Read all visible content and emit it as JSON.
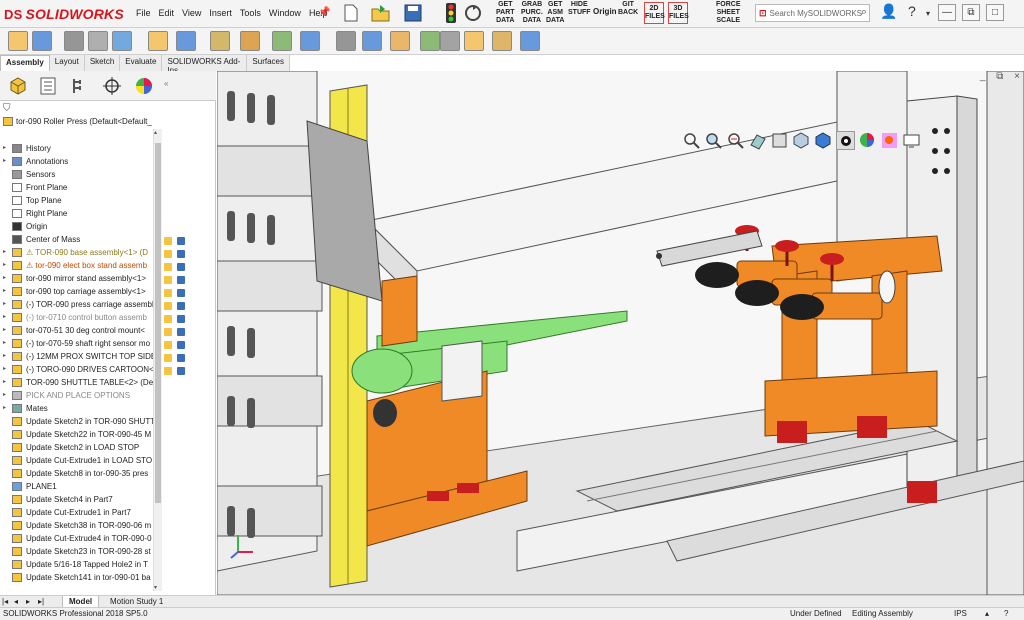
{
  "app": {
    "logo_ds": "DS",
    "logo_name": "SOLIDWORKS"
  },
  "menu": [
    "File",
    "Edit",
    "View",
    "Insert",
    "Tools",
    "Window",
    "Help"
  ],
  "custom_tools": [
    {
      "label": "GET\nPART\nDATA"
    },
    {
      "label": "GRAB\nPURC.\nDATA"
    },
    {
      "label": "GET\nASM\nDATA"
    },
    {
      "label": "HIDE\nSTUFF"
    },
    {
      "label": "Origin"
    },
    {
      "label": "GIT\nBACK"
    },
    {
      "label": "2D\nFILES"
    },
    {
      "label": "3D\nFILES"
    },
    {
      "label": "FORCE\nSHEET\nSCALE"
    }
  ],
  "search": {
    "placeholder": "Search MySOLIDWORKS"
  },
  "command_tabs": [
    "Assembly",
    "Layout",
    "Sketch",
    "Evaluate",
    "SOLIDWORKS Add-Ins",
    "Surfaces"
  ],
  "tree": [
    {
      "label": "tor-090 Roller Press  (Default<Default_",
      "icon": "assembly",
      "expand": "",
      "style": "normal"
    },
    {
      "label": "History",
      "icon": "history",
      "expand": "▸",
      "style": "normal"
    },
    {
      "label": "Annotations",
      "icon": "annotation",
      "expand": "▸",
      "style": "normal"
    },
    {
      "label": "Sensors",
      "icon": "sensor",
      "expand": "",
      "style": "normal"
    },
    {
      "label": "Front Plane",
      "icon": "plane",
      "expand": "",
      "style": "normal"
    },
    {
      "label": "Top Plane",
      "icon": "plane",
      "expand": "",
      "style": "normal"
    },
    {
      "label": "Right Plane",
      "icon": "plane",
      "expand": "",
      "style": "normal"
    },
    {
      "label": "Origin",
      "icon": "origin",
      "expand": "",
      "style": "normal"
    },
    {
      "label": "Center of Mass",
      "icon": "mass",
      "expand": "",
      "style": "normal"
    },
    {
      "label": "⚠ TOR-090 base assembly<1> (D",
      "icon": "warn-asm",
      "expand": "▸",
      "style": "warn"
    },
    {
      "label": "⚠ tor-090 elect box stand assemb",
      "icon": "warn-asm",
      "expand": "▸",
      "style": "warn2"
    },
    {
      "label": "tor-090 mirror stand assembly<1>",
      "icon": "asm",
      "expand": "▸",
      "style": "normal"
    },
    {
      "label": "tor-090 top carriage assembly<1>",
      "icon": "asm",
      "expand": "▸",
      "style": "normal"
    },
    {
      "label": "(-) TOR-090 press carriage assembl",
      "icon": "asm",
      "expand": "▸",
      "style": "normal"
    },
    {
      "label": "(-) tor-0710 control button assemb",
      "icon": "asm",
      "expand": "▸",
      "style": "gray"
    },
    {
      "label": "tor-070-51 30 deg control mount<",
      "icon": "asm",
      "expand": "▸",
      "style": "normal"
    },
    {
      "label": "(-) tor-070-59 shaft right sensor mo",
      "icon": "asm",
      "expand": "▸",
      "style": "normal"
    },
    {
      "label": "(-) 12MM PROX SWITCH TOP SIDE",
      "icon": "asm",
      "expand": "▸",
      "style": "normal"
    },
    {
      "label": "(-) TORO-090 DRIVES CARTOON<1",
      "icon": "asm",
      "expand": "▸",
      "style": "normal"
    },
    {
      "label": "TOR-090 SHUTTLE TABLE<2> (Def",
      "icon": "asm",
      "expand": "▸",
      "style": "normal"
    },
    {
      "label": "PICK AND PLACE OPTIONS",
      "icon": "folder",
      "expand": "▸",
      "style": "gray"
    },
    {
      "label": "Mates",
      "icon": "mates",
      "expand": "▸",
      "style": "normal"
    },
    {
      "label": "Update Sketch2 in TOR-090 SHUTT",
      "icon": "macro",
      "expand": "",
      "style": "normal"
    },
    {
      "label": "Update Sketch22 in TOR-090-45 M",
      "icon": "macro",
      "expand": "",
      "style": "normal"
    },
    {
      "label": "Update Sketch2 in LOAD STOP",
      "icon": "macro",
      "expand": "",
      "style": "normal"
    },
    {
      "label": "Update Cut-Extrude1 in LOAD STO",
      "icon": "macro",
      "expand": "",
      "style": "normal"
    },
    {
      "label": "Update Sketch8 in tor-090-35 pres",
      "icon": "macro",
      "expand": "",
      "style": "normal"
    },
    {
      "label": "PLANE1",
      "icon": "plane-blue",
      "expand": "",
      "style": "normal"
    },
    {
      "label": "Update Sketch4 in Part7",
      "icon": "macro",
      "expand": "",
      "style": "normal"
    },
    {
      "label": "Update Cut-Extrude1 in Part7",
      "icon": "macro",
      "expand": "",
      "style": "normal"
    },
    {
      "label": "Update Sketch38 in TOR-090-06 m",
      "icon": "macro",
      "expand": "",
      "style": "normal"
    },
    {
      "label": "Update Cut-Extrude4 in TOR-090-0",
      "icon": "macro",
      "expand": "",
      "style": "normal"
    },
    {
      "label": "Update Sketch23 in TOR-090-28 st",
      "icon": "macro",
      "expand": "",
      "style": "normal"
    },
    {
      "label": "Update 5/16-18 Tapped Hole2 in T",
      "icon": "macro",
      "expand": "",
      "style": "normal"
    },
    {
      "label": "Update Sketch141 in tor-090-01 ba",
      "icon": "macro",
      "expand": "",
      "style": "normal"
    }
  ],
  "bottom_tabs": [
    "Model",
    "Motion Study 1"
  ],
  "status": {
    "version": "SOLIDWORKS Professional 2018 SP5.0",
    "defined": "Under Defined",
    "mode": "Editing Assembly",
    "units": "IPS"
  },
  "colors": {
    "orange": "#f08a26",
    "green": "#8ae07a",
    "yellow": "#f2e64a",
    "red": "#c81e1e",
    "frame": "#e8e8e8",
    "accent": "#d9141b"
  }
}
